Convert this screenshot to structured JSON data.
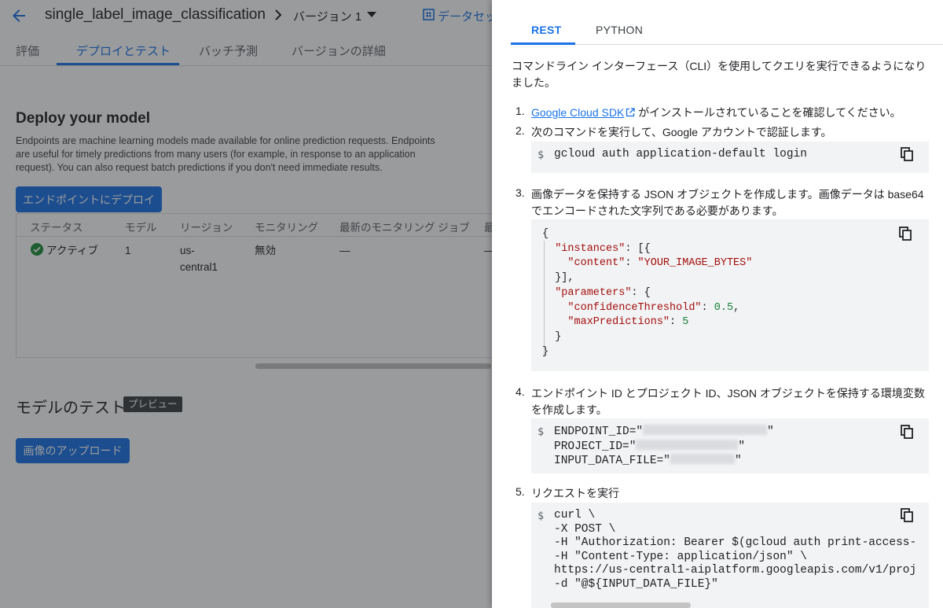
{
  "header": {
    "title": "single_label_image_classification",
    "version": "バージョン 1",
    "dataset_link": "データセッ"
  },
  "tabs": [
    {
      "label": "評価"
    },
    {
      "label": "デプロイとテスト"
    },
    {
      "label": "バッチ予測"
    },
    {
      "label": "バージョンの詳細"
    }
  ],
  "deploy": {
    "heading": "Deploy your model",
    "description": "Endpoints are machine learning models made available for online prediction requests. Endpoints are useful for timely predictions from many users (for example, in response to an application request). You can also request batch predictions if you don't need immediate results.",
    "button": "エンドポイントにデプロイ"
  },
  "table": {
    "headers": [
      "ステータス",
      "モデル",
      "リージョン",
      "モニタリング",
      "最新のモニタリング ジョブ",
      "最"
    ],
    "row": {
      "status": "アクティブ",
      "model": "1",
      "region_line1": "us-",
      "region_line2": "central1",
      "monitoring": "無効",
      "latest_job": "—",
      "last": "—"
    }
  },
  "test": {
    "heading": "モデルのテスト",
    "badge": "プレビュー",
    "upload_button": "画像のアップロード"
  },
  "panel": {
    "tabs": {
      "rest": "REST",
      "python": "PYTHON"
    },
    "intro": "コマンドライン インターフェース（CLI）を使用してクエリを実行できるようになりました。",
    "steps": {
      "n1": "1.",
      "n2": "2.",
      "n3": "3.",
      "n4": "4.",
      "n5": "5.",
      "s1_link": "Google Cloud SDK",
      "s1_rest": "がインストールされていることを確認してください。",
      "s2": "次のコマンドを実行して、Google アカウントで認証します。",
      "s3": "画像データを保持する JSON オブジェクトを作成します。画像データは base64 でエンコードされた文字列である必要があります。",
      "s4": "エンドポイント ID とプロジェクト ID、JSON オブジェクトを保持する環境変数を作成します。",
      "s5": "リクエストを実行"
    },
    "prompt": "$",
    "code_login": "gcloud auth application-default login",
    "json": {
      "open": "{",
      "instances_key": "\"instances\"",
      "instances_rest": ": [{",
      "content_key": "\"content\"",
      "content_val": "\"YOUR_IMAGE_BYTES\"",
      "close_inst": "}],",
      "params_key": "\"parameters\"",
      "params_rest": ": {",
      "conf_key": "\"confidenceThreshold\"",
      "conf_val": "0.5",
      "max_key": "\"maxPredictions\"",
      "max_val": "5",
      "close_params": "}",
      "close": "}"
    },
    "env": {
      "endpoint_prefix": "ENDPOINT_ID=\"",
      "project_prefix": "PROJECT_ID=\"",
      "input_prefix": "INPUT_DATA_FILE=\"",
      "quote": "\""
    },
    "curl": {
      "l1": "curl \\",
      "l2": "-X POST \\",
      "l3": "-H \"Authorization: Bearer $(gcloud auth print-access-",
      "l4": "-H \"Content-Type: application/json\" \\",
      "l5": "https://us-central1-aiplatform.googleapis.com/v1/proj",
      "l6": "-d \"@${INPUT_DATA_FILE}\""
    }
  },
  "colors": {
    "accent": "#1a73e8",
    "active": "#1e8e3e",
    "code_bg": "#f1f3f4"
  }
}
